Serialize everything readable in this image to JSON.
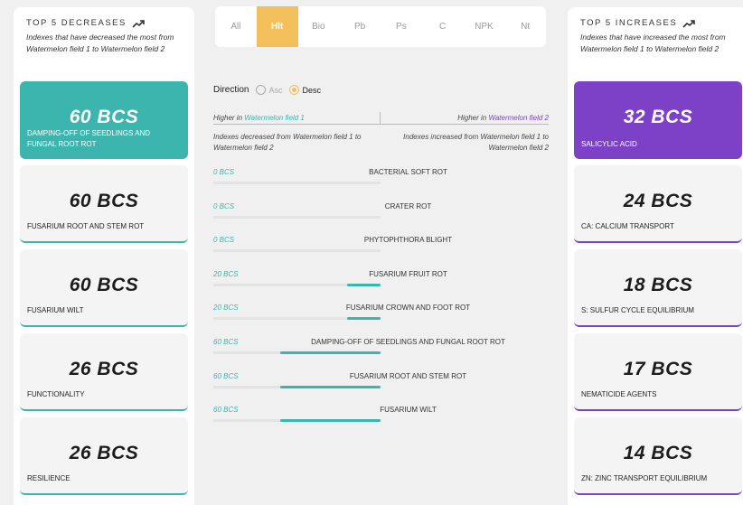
{
  "decreases": {
    "title": "TOP 5 DECREASES",
    "description": "Indexes that have decreased the most from Watermelon field 1 to Watermelon field 2",
    "cards": [
      {
        "value": "60 BCS",
        "label": "DAMPING-OFF OF SEEDLINGS AND FUNGAL ROOT ROT",
        "active": true
      },
      {
        "value": "60 BCS",
        "label": "FUSARIUM ROOT AND STEM ROT",
        "active": false
      },
      {
        "value": "60 BCS",
        "label": "FUSARIUM WILT",
        "active": false
      },
      {
        "value": "26 BCS",
        "label": "FUNCTIONALITY",
        "active": false
      },
      {
        "value": "26 BCS",
        "label": "RESILIENCE",
        "active": false
      }
    ]
  },
  "increases": {
    "title": "TOP 5 INCREASES",
    "description": "Indexes that have increased the most from Watermelon field 1 to Watermelon field 2",
    "cards": [
      {
        "value": "32 BCS",
        "label": "SALICYLIC ACID",
        "active": true
      },
      {
        "value": "24 BCS",
        "label": "CA: CALCIUM TRANSPORT",
        "active": false
      },
      {
        "value": "18 BCS",
        "label": "S: SULFUR CYCLE EQUILIBRIUM",
        "active": false
      },
      {
        "value": "17 BCS",
        "label": "NEMATICIDE AGENTS",
        "active": false
      },
      {
        "value": "14 BCS",
        "label": "ZN: ZINC TRANSPORT EQUILIBRIUM",
        "active": false
      }
    ]
  },
  "tabs": [
    {
      "label": "All",
      "active": false
    },
    {
      "label": "Hlt",
      "active": true
    },
    {
      "label": "Bio",
      "active": false
    },
    {
      "label": "Pb",
      "active": false
    },
    {
      "label": "Ps",
      "active": false
    },
    {
      "label": "C",
      "active": false
    },
    {
      "label": "NPK",
      "active": false
    },
    {
      "label": "Nt",
      "active": false
    }
  ],
  "direction": {
    "label": "Direction",
    "options": [
      {
        "label": "Asc",
        "checked": false
      },
      {
        "label": "Desc",
        "checked": true
      }
    ]
  },
  "legend": {
    "left_prefix": "Higher in ",
    "left_field": "Watermelon field 1",
    "right_prefix": "Higher in ",
    "right_field": "Watermelon field 2",
    "left_desc": "Indexes decreased from Watermelon field 1 to Watermelon field 2",
    "right_desc": "Indexes increased from Watermelon field 1 to Watermelon field 2"
  },
  "rows": [
    {
      "value": "0 BCS",
      "name": "BACTERIAL SOFT ROT",
      "fraction": 0
    },
    {
      "value": "0 BCS",
      "name": "CRATER ROT",
      "fraction": 0
    },
    {
      "value": "0 BCS",
      "name": "PHYTOPHTHORA BLIGHT",
      "fraction": 0
    },
    {
      "value": "20 BCS",
      "name": "FUSARIUM FRUIT ROT",
      "fraction": 0.2
    },
    {
      "value": "20 BCS",
      "name": "FUSARIUM CROWN AND FOOT ROT",
      "fraction": 0.2
    },
    {
      "value": "60 BCS",
      "name": "DAMPING-OFF OF SEEDLINGS AND FUNGAL ROOT ROT",
      "fraction": 0.6
    },
    {
      "value": "60 BCS",
      "name": "FUSARIUM ROOT AND STEM ROT",
      "fraction": 0.6
    },
    {
      "value": "60 BCS",
      "name": "FUSARIUM WILT",
      "fraction": 0.6
    }
  ],
  "colors": {
    "teal": "#3bb5ad",
    "purple": "#7b43c6",
    "accent": "#f2bf5a"
  }
}
